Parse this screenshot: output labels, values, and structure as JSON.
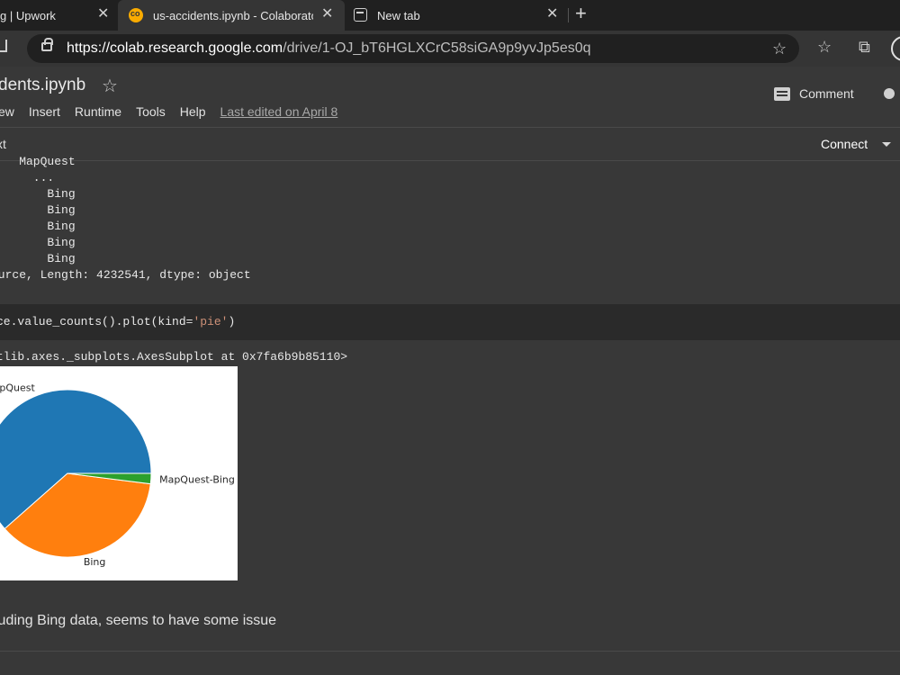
{
  "browser": {
    "tabs": [
      {
        "label": "g | Upwork"
      },
      {
        "label": "us-accidents.ipynb - Colaboratory"
      },
      {
        "label": "New tab"
      }
    ],
    "url_host": "https://colab.research.google.com",
    "url_path": "/drive/1-OJ_bT6HGLXCrC58siGA9p9yvJp5es0q"
  },
  "colab": {
    "notebook_title": "dents.ipynb",
    "menu": [
      "ew",
      "Insert",
      "Runtime",
      "Tools",
      "Help"
    ],
    "last_edited": "Last edited on April 8",
    "comment_label": "Comment",
    "toolbar_text": "xt",
    "connect_label": "Connect"
  },
  "cells": {
    "output1": "    MapQuest\n      ...\n        Bing\n        Bing\n        Bing\n        Bing\n        Bing\nource, Length: 4232541, dtype: object",
    "code_prefix": "ce.value_counts().plot(kind=",
    "code_string": "'pie'",
    "code_suffix": ")",
    "output2": "tlib.axes._subplots.AxesSubplot at 0x7fa6b9b85110>",
    "markdown": "luding Bing data, seems to have some issue"
  },
  "chart_data": {
    "type": "pie",
    "categories": [
      "MapQuest",
      "Bing",
      "MapQuest-Bing"
    ],
    "values": [
      61.5,
      36.5,
      2
    ],
    "colors": [
      "#1f77b4",
      "#ff7f0e",
      "#2ca02c"
    ]
  }
}
